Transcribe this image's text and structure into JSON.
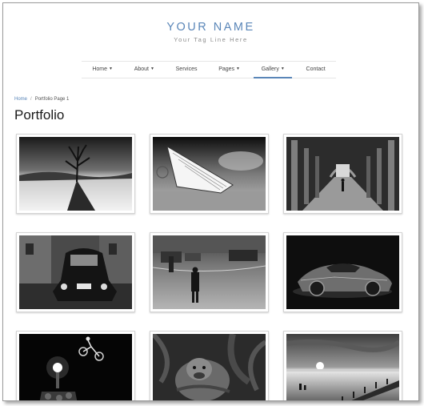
{
  "header": {
    "brand_name": "YOUR NAME",
    "tagline": "Your Tag Line Here"
  },
  "nav": {
    "items": [
      {
        "label": "Home",
        "has_dropdown": true
      },
      {
        "label": "About",
        "has_dropdown": true
      },
      {
        "label": "Services",
        "has_dropdown": false
      },
      {
        "label": "Pages",
        "has_dropdown": true
      },
      {
        "label": "Gallery",
        "has_dropdown": true,
        "active": true
      },
      {
        "label": "Contact",
        "has_dropdown": false
      }
    ],
    "accent_color": "#5a86b8"
  },
  "breadcrumb": {
    "home": "Home",
    "separator": "/",
    "current": "Portfolio Page 1"
  },
  "page": {
    "title": "Portfolio"
  },
  "gallery": {
    "items": [
      {
        "subject": "dead-tree-desert"
      },
      {
        "subject": "rowboat-on-beach"
      },
      {
        "subject": "arched-colonnade-walker"
      },
      {
        "subject": "vintage-car-street"
      },
      {
        "subject": "rainy-street-man"
      },
      {
        "subject": "sports-car"
      },
      {
        "subject": "bike-jump-night"
      },
      {
        "subject": "orangutan"
      },
      {
        "subject": "seaside-sunset-pier"
      }
    ]
  }
}
